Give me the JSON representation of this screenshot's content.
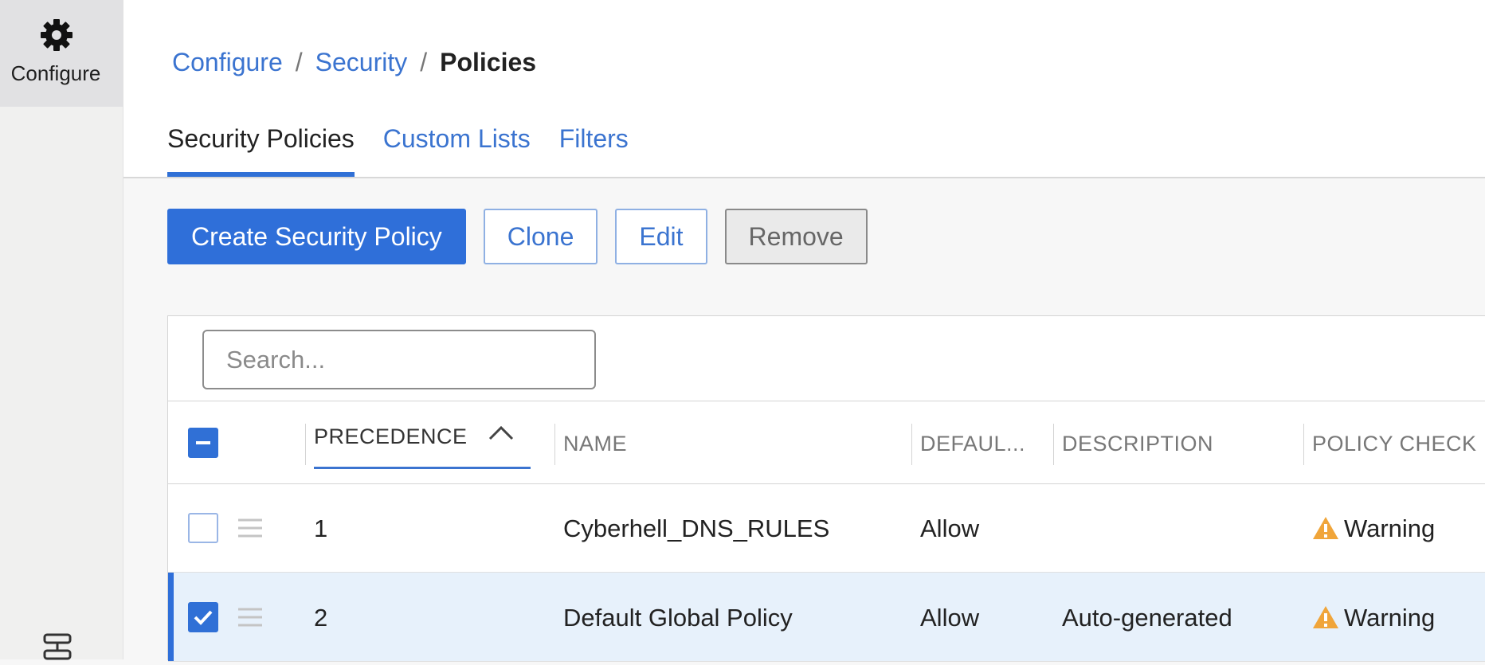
{
  "nav": {
    "configure_label": "Configure",
    "configure_icon": "gear-icon",
    "bottom_icon": "network-icon"
  },
  "breadcrumb": {
    "items": [
      "Configure",
      "Security"
    ],
    "current": "Policies",
    "separator": "/"
  },
  "tabs": [
    {
      "label": "Security Policies",
      "active": true
    },
    {
      "label": "Custom Lists",
      "active": false
    },
    {
      "label": "Filters",
      "active": false
    }
  ],
  "toolbar": {
    "create_label": "Create Security Policy",
    "clone_label": "Clone",
    "edit_label": "Edit",
    "remove_label": "Remove"
  },
  "search": {
    "placeholder": "Search...",
    "value": ""
  },
  "table": {
    "columns": {
      "precedence": "PRECEDENCE",
      "name": "NAME",
      "default": "DEFAUL...",
      "description": "DESCRIPTION",
      "policy_check": "POLICY CHECK"
    },
    "sort": {
      "column": "precedence",
      "direction": "ascending"
    },
    "header_checkbox_state": "indeterminate",
    "rows": [
      {
        "precedence": "1",
        "name": "Cyberhell_DNS_RULES",
        "default": "Allow",
        "description": "",
        "policy_check": "Warning",
        "selected": false
      },
      {
        "precedence": "2",
        "name": "Default Global Policy",
        "default": "Allow",
        "description": "Auto-generated",
        "policy_check": "Warning",
        "selected": true
      }
    ]
  },
  "colors": {
    "accent": "#2f6fd9",
    "link": "#3b74d0",
    "warning": "#f0a53a",
    "selected_row": "#e7f1fb",
    "nav_bg": "#f0f0ef"
  }
}
